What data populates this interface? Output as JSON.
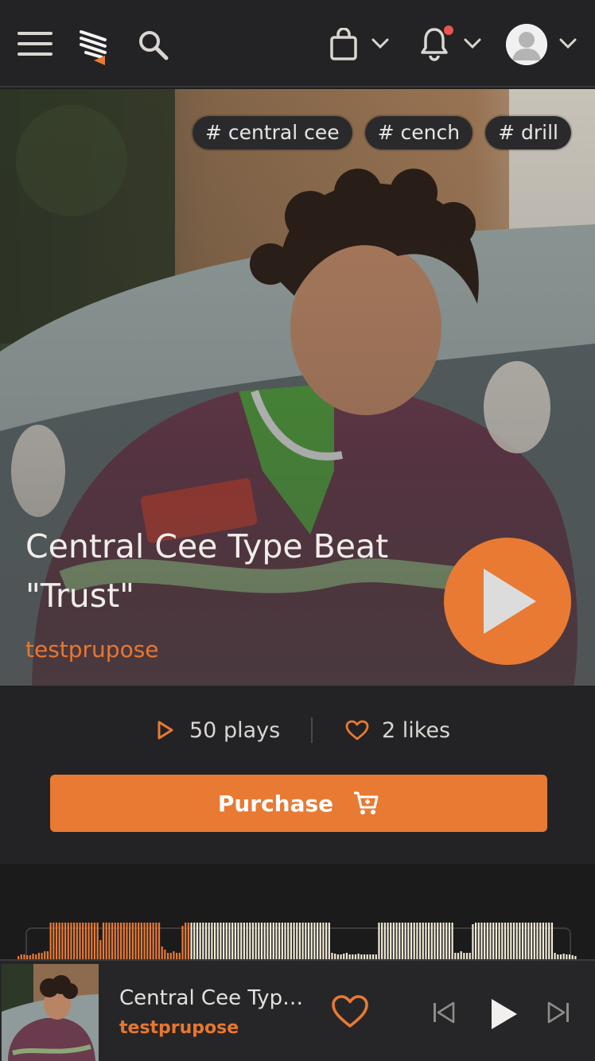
{
  "nav": {
    "menu_icon": "hamburger-icon",
    "logo_icon": "logo-icon",
    "search_icon": "search-icon",
    "cart_icon": "shopping-bag-icon",
    "notifications_icon": "bell-icon",
    "account_icon": "user-avatar-icon",
    "has_notification": true
  },
  "track": {
    "title": "Central Cee Type Beat \"Trust\"",
    "author": "testprupose",
    "tags": [
      "# central cee",
      "# cench",
      "# drill"
    ],
    "plays": "50 plays",
    "likes": "2 likes"
  },
  "actions": {
    "purchase_label": "Purchase"
  },
  "waveform": {
    "progress": 0.31
  },
  "player": {
    "title": "Central Cee Type Beat \"Trust\"",
    "author": "testprupose"
  },
  "colors": {
    "accent": "#e87a34",
    "background": "#1e1e1f",
    "wave_played": "#e87a34",
    "wave_unplayed": "#f2ead6"
  }
}
